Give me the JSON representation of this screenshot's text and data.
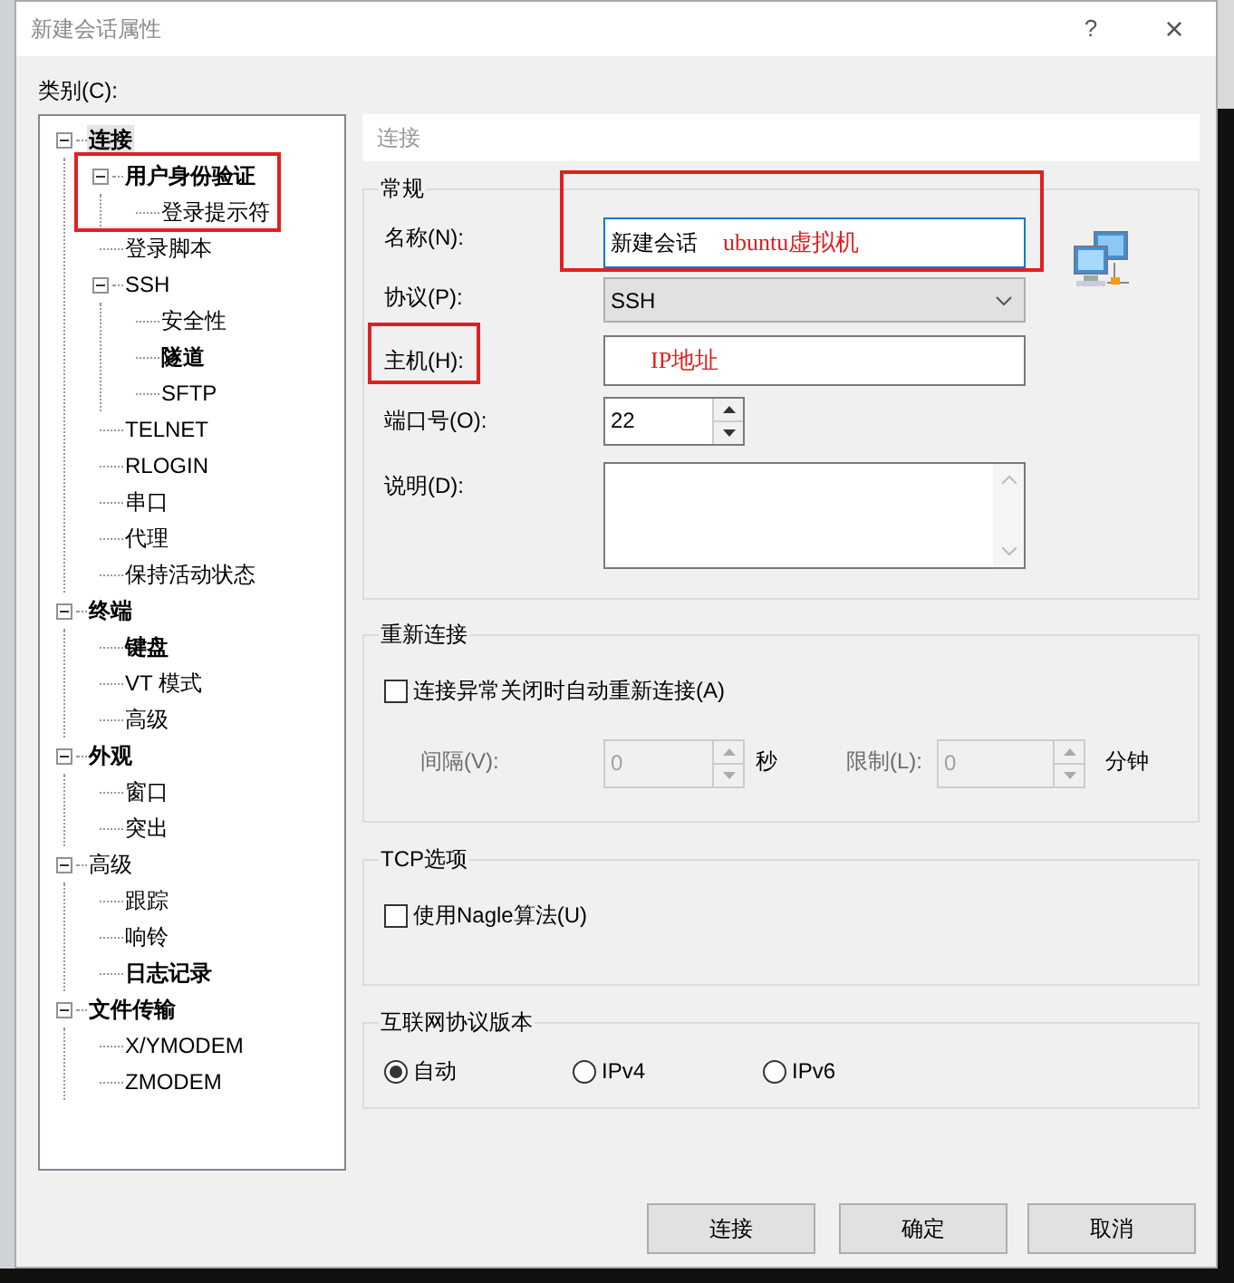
{
  "window": {
    "title": "新建会话属性",
    "help": "?",
    "close": "×"
  },
  "category_label": "类别(C):",
  "tree": [
    {
      "label": "连接",
      "bold": true,
      "selected": true,
      "expanded": true,
      "children": [
        {
          "label": "用户身份验证",
          "bold": true,
          "selected": false,
          "expanded": true,
          "children": [
            {
              "label": "登录提示符",
              "bold": false,
              "selected": false
            }
          ]
        },
        {
          "label": "登录脚本",
          "bold": false,
          "selected": false
        },
        {
          "label": "SSH",
          "bold": false,
          "selected": false,
          "expanded": true,
          "children": [
            {
              "label": "安全性",
              "bold": false,
              "selected": false
            },
            {
              "label": "隧道",
              "bold": true,
              "selected": false
            },
            {
              "label": "SFTP",
              "bold": false,
              "selected": false
            }
          ]
        },
        {
          "label": "TELNET",
          "bold": false,
          "selected": false
        },
        {
          "label": "RLOGIN",
          "bold": false,
          "selected": false
        },
        {
          "label": "串口",
          "bold": false,
          "selected": false
        },
        {
          "label": "代理",
          "bold": false,
          "selected": false
        },
        {
          "label": "保持活动状态",
          "bold": false,
          "selected": false
        }
      ]
    },
    {
      "label": "终端",
      "bold": true,
      "selected": false,
      "expanded": true,
      "children": [
        {
          "label": "键盘",
          "bold": true,
          "selected": false
        },
        {
          "label": "VT 模式",
          "bold": false,
          "selected": false
        },
        {
          "label": "高级",
          "bold": false,
          "selected": false
        }
      ]
    },
    {
      "label": "外观",
      "bold": true,
      "selected": false,
      "expanded": true,
      "children": [
        {
          "label": "窗口",
          "bold": false,
          "selected": false
        },
        {
          "label": "突出",
          "bold": false,
          "selected": false
        }
      ]
    },
    {
      "label": "高级",
      "bold": false,
      "selected": false,
      "expanded": true,
      "children": [
        {
          "label": "跟踪",
          "bold": false,
          "selected": false
        },
        {
          "label": "响铃",
          "bold": false,
          "selected": false
        },
        {
          "label": "日志记录",
          "bold": true,
          "selected": false
        }
      ]
    },
    {
      "label": "文件传输",
      "bold": true,
      "selected": false,
      "expanded": true,
      "children": [
        {
          "label": "X/YMODEM",
          "bold": false,
          "selected": false
        },
        {
          "label": "ZMODEM",
          "bold": false,
          "selected": false
        }
      ]
    }
  ],
  "page_header": "连接",
  "general": {
    "title": "常规",
    "name": {
      "label": "名称(N):",
      "value": "新建会话",
      "annotation": "ubuntu虚拟机"
    },
    "protocol": {
      "label": "协议(P):",
      "value": "SSH"
    },
    "host": {
      "label": "主机(H):",
      "annotation": "IP地址"
    },
    "port": {
      "label": "端口号(O):",
      "value": "22"
    },
    "description": {
      "label": "说明(D):"
    }
  },
  "reconnect": {
    "title": "重新连接",
    "checkbox": {
      "label": "连接异常关闭时自动重新连接(A)",
      "checked": false
    },
    "interval": {
      "label": "间隔(V):",
      "value": "0",
      "unit": "秒",
      "disabled": true
    },
    "limit": {
      "label": "限制(L):",
      "value": "0",
      "unit": "分钟",
      "disabled": true
    }
  },
  "tcp": {
    "title": "TCP选项",
    "checkbox": {
      "label": "使用Nagle算法(U)",
      "checked": false
    }
  },
  "ip_version": {
    "title": "互联网协议版本",
    "options": [
      {
        "label": "自动",
        "selected": true
      },
      {
        "label": "IPv4",
        "selected": false
      },
      {
        "label": "IPv6",
        "selected": false
      }
    ]
  },
  "buttons": [
    "连接",
    "确定",
    "取消"
  ]
}
